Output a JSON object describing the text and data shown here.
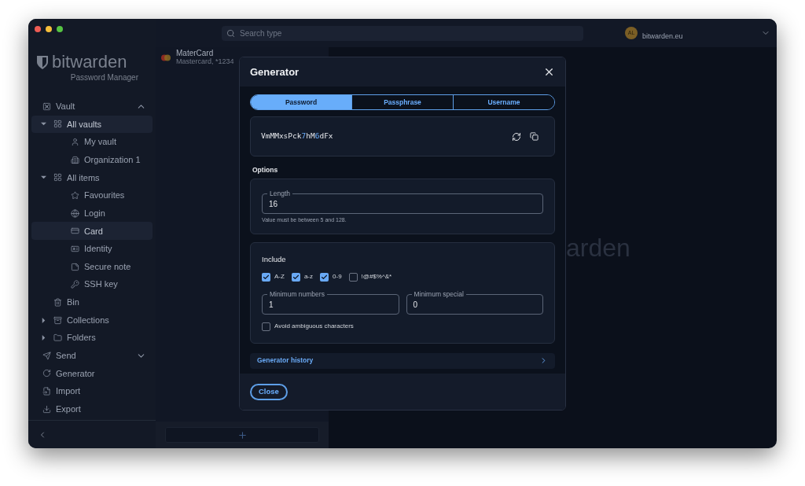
{
  "search": {
    "placeholder": "Search type"
  },
  "account": {
    "initials": "AL",
    "server": "bitwarden.eu"
  },
  "logo": {
    "name": "**bit**warden",
    "subtitle": "Password Manager"
  },
  "sidebar": {
    "items": [
      {
        "label": "Vault",
        "kind": "section",
        "expanded": true,
        "children": [
          {
            "label": "All vaults",
            "kind": "group",
            "expanded": true,
            "selected": true,
            "children": [
              {
                "label": "My vault",
                "selected": false
              },
              {
                "label": "Organization 1",
                "selected": false
              }
            ]
          },
          {
            "label": "All items",
            "kind": "group",
            "expanded": true,
            "selected": false,
            "children": [
              {
                "label": "Favourites",
                "selected": false
              },
              {
                "label": "Login",
                "selected": false
              },
              {
                "label": "Card",
                "selected": true
              },
              {
                "label": "Identity",
                "selected": false
              },
              {
                "label": "Secure note",
                "selected": false
              },
              {
                "label": "SSH key",
                "selected": false
              }
            ]
          },
          {
            "label": "Bin",
            "kind": "link",
            "selected": false
          },
          {
            "label": "Collections",
            "kind": "group",
            "expanded": false,
            "selected": false
          },
          {
            "label": "Folders",
            "kind": "group",
            "expanded": false,
            "selected": false
          }
        ]
      },
      {
        "label": "Send",
        "kind": "section",
        "expanded": false
      },
      {
        "label": "Generator",
        "kind": "link",
        "selected": false
      },
      {
        "label": "Import",
        "kind": "link",
        "selected": false
      },
      {
        "label": "Export",
        "kind": "link",
        "selected": false
      }
    ]
  },
  "list": {
    "items": [
      {
        "title": "MaterCard",
        "subtitle": "Mastercard, *1234"
      }
    ]
  },
  "main": {
    "watermark": "arden"
  },
  "dialog": {
    "title": "Generator",
    "tabs": [
      {
        "label": "Password",
        "selected": true
      },
      {
        "label": "Passphrase",
        "selected": false
      },
      {
        "label": "Username",
        "selected": false
      }
    ],
    "password": [
      {
        "text": "VmMMxsPck",
        "kind": "letters"
      },
      {
        "text": "7",
        "kind": "digit"
      },
      {
        "text": "hM",
        "kind": "letters"
      },
      {
        "text": "6",
        "kind": "digit"
      },
      {
        "text": "dFx",
        "kind": "letters"
      }
    ],
    "options_label": "Options",
    "length": {
      "label": "Length",
      "value": "16",
      "hint": "Value must be between 5 and 128."
    },
    "include_label": "Include",
    "include": [
      {
        "label": "A-Z",
        "checked": true
      },
      {
        "label": "a-z",
        "checked": true
      },
      {
        "label": "0-9",
        "checked": true
      },
      {
        "label": "!@#$%^&*",
        "checked": false
      }
    ],
    "min_fields": [
      {
        "label": "Minimum numbers",
        "value": "1"
      },
      {
        "label": "Minimum special",
        "value": "0"
      }
    ],
    "avoid_ambiguous": {
      "label": "Avoid ambiguous characters",
      "checked": false
    },
    "history": "Generator history",
    "close": "Close"
  }
}
